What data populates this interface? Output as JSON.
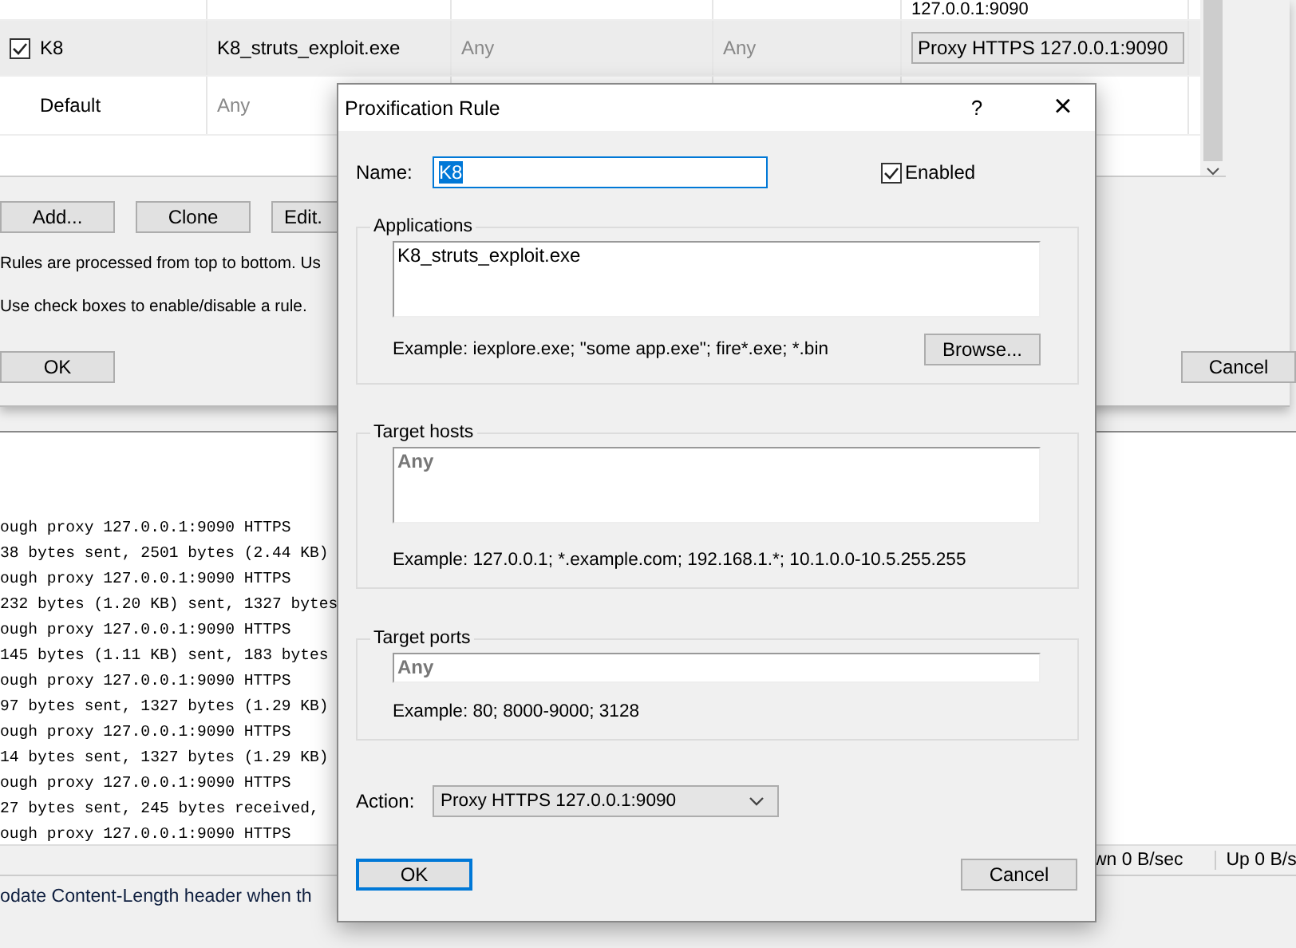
{
  "rules_window": {
    "table": {
      "rows": [
        {
          "kind": "partial",
          "selected": false,
          "cells": [
            {
              "kind": "empty"
            },
            {
              "kind": "empty"
            },
            {
              "kind": "empty"
            },
            {
              "kind": "empty"
            },
            {
              "kind": "text",
              "text": "127.0.0.1:9090"
            }
          ]
        },
        {
          "kind": "rule",
          "checked": true,
          "selected": true,
          "cells": [
            {
              "kind": "text",
              "text": "K8"
            },
            {
              "kind": "text",
              "text": "K8_struts_exploit.exe"
            },
            {
              "kind": "dim",
              "text": "Any"
            },
            {
              "kind": "dim",
              "text": "Any"
            },
            {
              "kind": "dropdown",
              "text": "Proxy HTTPS 127.0.0.1:9090"
            }
          ]
        },
        {
          "kind": "default",
          "selected": false,
          "cells": [
            {
              "kind": "text",
              "text": "Default"
            },
            {
              "kind": "dim",
              "text": "Any"
            }
          ]
        }
      ]
    },
    "buttons": [
      "Add...",
      "Clone",
      "Edit."
    ],
    "hints": [
      "Rules are processed from top to bottom. Us",
      "Use check boxes to enable/disable a rule."
    ],
    "ok": "OK",
    "cancel": "Cancel"
  },
  "log": {
    "lines": [
      "ough proxy 127.0.0.1:9090 HTTPS",
      "38 bytes sent, 2501 bytes (2.44 KB)",
      "ough proxy 127.0.0.1:9090 HTTPS",
      "232 bytes (1.20 KB) sent, 1327 bytes",
      "ough proxy 127.0.0.1:9090 HTTPS",
      "145 bytes (1.11 KB) sent, 183 bytes",
      "ough proxy 127.0.0.1:9090 HTTPS",
      "97 bytes sent, 1327 bytes (1.29 KB)",
      "ough proxy 127.0.0.1:9090 HTTPS",
      "14 bytes sent, 1327 bytes (1.29 KB)",
      "ough proxy 127.0.0.1:9090 HTTPS",
      "27 bytes sent, 245 bytes received,",
      "ough proxy 127.0.0.1:9090 HTTPS"
    ]
  },
  "status_bar": {
    "items": [
      "wn 0 B/sec",
      "Up 0 B/s"
    ]
  },
  "footer_text": "odate Content-Length header when th",
  "dialog": {
    "title": "Proxification Rule",
    "help": "?",
    "close": "×",
    "name": {
      "label": "Name:",
      "value": "K8"
    },
    "enabled": {
      "label": "Enabled",
      "checked": true
    },
    "groups": [
      {
        "kind": "multiline",
        "title": "Applications",
        "value": "K8_struts_exploit.exe",
        "example": "Example: iexplore.exe; \"some app.exe\"; fire*.exe; *.bin",
        "button": "Browse..."
      },
      {
        "kind": "multiline",
        "title": "Target hosts",
        "value": "Any",
        "example": "Example: 127.0.0.1; *.example.com; 192.168.1.*; 10.1.0.0-10.5.255.255"
      },
      {
        "kind": "single",
        "title": "Target ports",
        "value": "Any",
        "example": "Example: 80; 8000-9000; 3128"
      }
    ],
    "action": {
      "label": "Action:",
      "value": "Proxy HTTPS 127.0.0.1:9090"
    },
    "ok": "OK",
    "cancel": "Cancel"
  }
}
